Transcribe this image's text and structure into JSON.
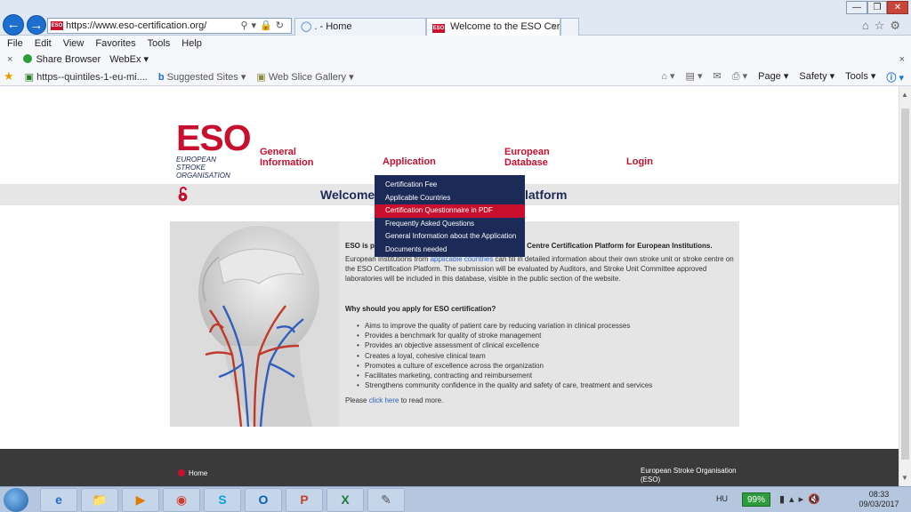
{
  "browser": {
    "url": "https://www.eso-certification.org/",
    "favicon_label": "ESO",
    "tabs": [
      {
        "label": ". - Home"
      },
      {
        "label": "Welcome to the ESO Certifi..."
      }
    ],
    "menubar": [
      "File",
      "Edit",
      "View",
      "Favorites",
      "Tools",
      "Help"
    ],
    "toolbar": {
      "share": "Share Browser",
      "webex": "WebEx"
    },
    "favorites": [
      {
        "label": "https--quintiles-1-eu-mi...."
      },
      {
        "label": "Suggested Sites"
      },
      {
        "label": "Web Slice Gallery"
      }
    ],
    "command_bar": [
      "Page",
      "Safety",
      "Tools"
    ]
  },
  "site": {
    "logo": {
      "text": "ESO",
      "sub1": "EUROPEAN STROKE",
      "sub2": "ORGANISATION"
    },
    "nav": {
      "general_1": "General",
      "general_2": "Information",
      "application": "Application",
      "european_1": "European",
      "european_2": "Database",
      "login": "Login"
    },
    "welcome_left": "Welcome",
    "welcome_right": "latform",
    "dropdown": [
      "Certification Fee",
      "Applicable Countries",
      "Certification Questionnaire in PDF",
      "Frequently Asked Questions",
      "General Information about the Application",
      "Documents needed"
    ],
    "dropdown_hover_index": 2,
    "content": {
      "intro_left": "ESO is p",
      "intro_right": "Stroke Centre Certification Platform for European Institutions.",
      "para_pre": "European Institutions from ",
      "para_link": "applicable countries",
      "para_post": " can fill in detailed information about their own stroke unit or stroke centre on the ESO Certification Platform. The submission will be evaluated by Auditors, and Stroke Unit Committee approved laboratories will be included in this database, visible in the public section of the website.",
      "why": "Why should you apply for ESO certification?",
      "bullets": [
        "Aims to improve the quality of patient care by reducing variation in clinical processes",
        "Provides a benchmark for quality of stroke management",
        "Provides an objective assessment of clinical excellence",
        "Creates a loyal, cohesive clinical team",
        "Promotes a culture of excellence across the organization",
        "Facilitates marketing, contracting and reimbursement",
        "Strengthens community confidence in the quality and safety of care, treatment and services"
      ],
      "read_pre": "Please ",
      "read_link": "click here",
      "read_post": " to read more."
    },
    "footer": {
      "home": "Home",
      "org_1": "European Stroke Organisation",
      "org_2": "(ESO)"
    }
  },
  "taskbar": {
    "apps": [
      "e",
      "📁",
      "▶",
      "◉",
      "S",
      "O",
      "P",
      "X",
      "✎"
    ],
    "lang": "HU",
    "battery": "99%",
    "time": "08:33",
    "date": "09/03/2017"
  },
  "colors": {
    "brand_red": "#c8102e",
    "brand_navy": "#1b2a57"
  }
}
